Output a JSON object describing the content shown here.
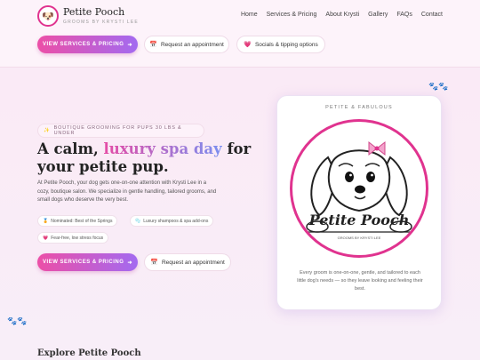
{
  "brand": {
    "name": "Petite Pooch",
    "tagline": "GROOMS BY KRYSTI LEE"
  },
  "nav": [
    "Home",
    "Services & Pricing",
    "About Krysti",
    "Gallery",
    "FAQs",
    "Contact"
  ],
  "header_actions": {
    "primary": "VIEW SERVICES & PRICING",
    "appointment": "Request an appointment",
    "socials": "Socials & tipping options"
  },
  "hero": {
    "badge": "BOUTIQUE GROOMING FOR PUPS 30 LBS & UNDER",
    "headline_pre": "A calm, ",
    "headline_accent": "luxury spa day",
    "headline_post": " for your petite pup.",
    "intro": "At Petite Pooch, your dog gets one-on-one attention with Krysti Lee in a cozy, boutique salon. We specialize in gentle handling, tailored grooms, and small dogs who deserve the very best.",
    "pills": [
      "Nominated: Best of the Springs",
      "Luxury shampoos & spa add-ons",
      "Fear-free, low stress focus"
    ],
    "primary_button": "VIEW SERVICES & PRICING",
    "appointment_button": "Request an appointment"
  },
  "card": {
    "title": "PETITE & FABULOUS",
    "logo_text": "Petite Pooch",
    "logo_subtext": "GROOMS BY KRYSTI LEE",
    "description": "Every groom is one-on-one, gentle, and tailored to each little dog's needs — so they leave looking and feeling their best."
  },
  "section": {
    "explore_title": "Explore Petite Pooch"
  },
  "colors": {
    "accent": "#e0338f",
    "gradient_start": "#ec4fa7",
    "gradient_end": "#a36af0"
  },
  "icons": {
    "arrow": "arrow-right-icon",
    "calendar": "calendar-icon",
    "heart": "heart-icon",
    "sparkle": "sparkle-icon",
    "medal": "medal-icon",
    "bubbles": "bubbles-icon",
    "paw": "paw-icon"
  }
}
